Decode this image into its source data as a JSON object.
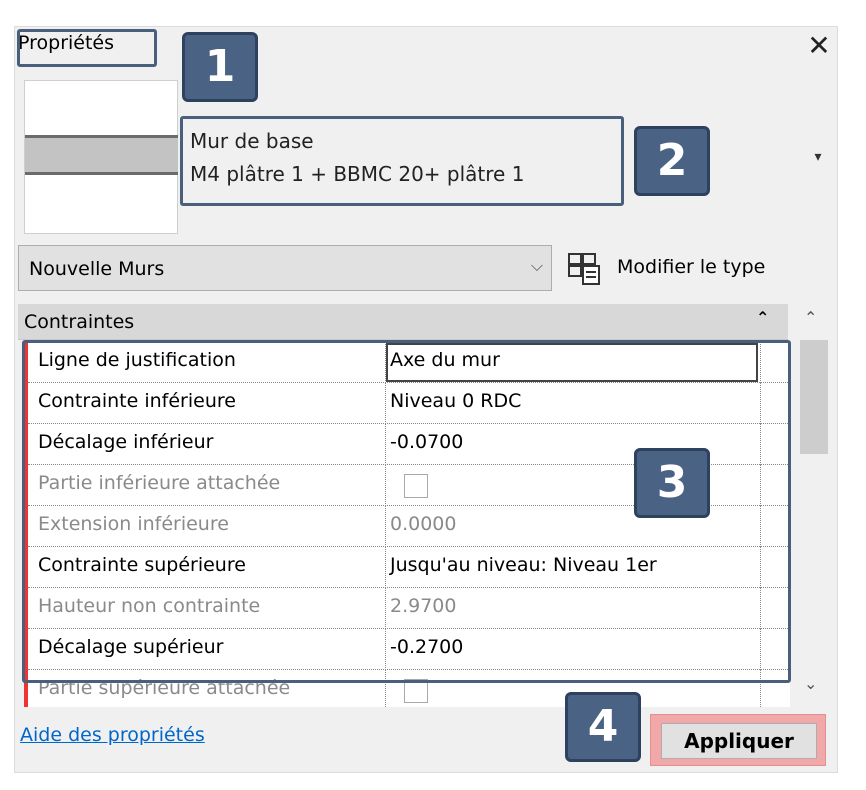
{
  "panel": {
    "title": "Propriétés",
    "close_glyph": "✕"
  },
  "type_selector": {
    "family": "Mur de base",
    "type": "M4 plâtre 1 + BBMC 20+ plâtre 1",
    "dropdown_glyph": "▾"
  },
  "filter": {
    "selected": "Nouvelle Murs",
    "chevron": "⌵"
  },
  "modify_type": {
    "label": "Modifier le type",
    "icon": "edit-type-icon"
  },
  "section": {
    "label": "Contraintes",
    "collapse_glyph": "⌃"
  },
  "properties": [
    {
      "name": "Ligne de justification",
      "value": "Axe du mur",
      "disabled": false,
      "kind": "text"
    },
    {
      "name": "Contrainte inférieure",
      "value": "Niveau 0 RDC",
      "disabled": false,
      "kind": "text"
    },
    {
      "name": "Décalage inférieur",
      "value": "-0.0700",
      "disabled": false,
      "kind": "text"
    },
    {
      "name": "Partie inférieure attachée",
      "value": "",
      "disabled": true,
      "kind": "checkbox"
    },
    {
      "name": "Extension inférieure",
      "value": "0.0000",
      "disabled": true,
      "kind": "text"
    },
    {
      "name": "Contrainte supérieure",
      "value": "Jusqu'au niveau: Niveau 1er",
      "disabled": false,
      "kind": "text"
    },
    {
      "name": "Hauteur non contrainte",
      "value": "2.9700",
      "disabled": true,
      "kind": "text"
    },
    {
      "name": "Décalage supérieur",
      "value": "-0.2700",
      "disabled": false,
      "kind": "text"
    },
    {
      "name": "Partie supérieure attachée",
      "value": "",
      "disabled": true,
      "kind": "checkbox"
    }
  ],
  "scrollbar": {
    "up_glyph": "⌃",
    "down_glyph": "⌄"
  },
  "footer": {
    "help_link": "Aide des propriétés",
    "apply_label": "Appliquer"
  },
  "badges": [
    "1",
    "2",
    "3",
    "4"
  ],
  "colors": {
    "badge": "#4a6284",
    "highlight_box": "#4a5f7c",
    "apply_highlight": "#f2a8a8",
    "link": "#0066cc"
  }
}
